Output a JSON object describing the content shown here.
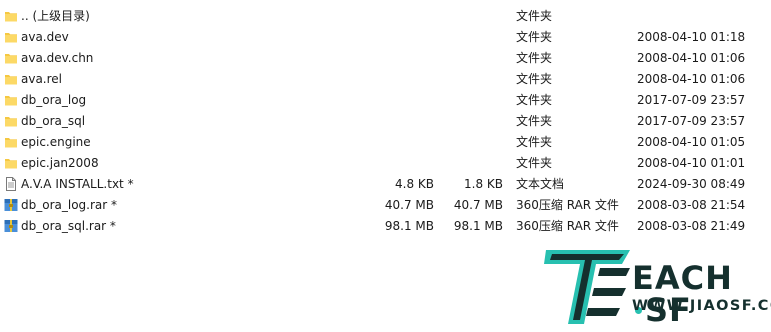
{
  "files": [
    {
      "name": ".. (上级目录)",
      "size": "",
      "packed": "",
      "type": "文件夹",
      "date": "",
      "icon": "folder-icon"
    },
    {
      "name": "ava.dev",
      "size": "",
      "packed": "",
      "type": "文件夹",
      "date": "2008-04-10 01:18",
      "icon": "folder-icon"
    },
    {
      "name": "ava.dev.chn",
      "size": "",
      "packed": "",
      "type": "文件夹",
      "date": "2008-04-10 01:06",
      "icon": "folder-icon"
    },
    {
      "name": "ava.rel",
      "size": "",
      "packed": "",
      "type": "文件夹",
      "date": "2008-04-10 01:06",
      "icon": "folder-icon"
    },
    {
      "name": "db_ora_log",
      "size": "",
      "packed": "",
      "type": "文件夹",
      "date": "2017-07-09 23:57",
      "icon": "folder-icon"
    },
    {
      "name": "db_ora_sql",
      "size": "",
      "packed": "",
      "type": "文件夹",
      "date": "2017-07-09 23:57",
      "icon": "folder-icon"
    },
    {
      "name": "epic.engine",
      "size": "",
      "packed": "",
      "type": "文件夹",
      "date": "2008-04-10 01:05",
      "icon": "folder-icon"
    },
    {
      "name": "epic.jan2008",
      "size": "",
      "packed": "",
      "type": "文件夹",
      "date": "2008-04-10 01:01",
      "icon": "folder-icon"
    },
    {
      "name": "A.V.A INSTALL.txt *",
      "size": "4.8 KB",
      "packed": "1.8 KB",
      "type": "文本文档",
      "date": "2024-09-30 08:49",
      "icon": "text-file-icon"
    },
    {
      "name": "db_ora_log.rar *",
      "size": "40.7 MB",
      "packed": "40.7 MB",
      "type": "360压缩 RAR 文件",
      "date": "2008-03-08 21:54",
      "icon": "rar-archive-icon"
    },
    {
      "name": "db_ora_sql.rar *",
      "size": "98.1 MB",
      "packed": "98.1 MB",
      "type": "360压缩 RAR 文件",
      "date": "2008-03-08 21:49",
      "icon": "rar-archive-icon"
    }
  ],
  "watermark": {
    "brand_left": "EACH",
    "brand_right": "SF",
    "url": "WWW.JIAOSF.COM",
    "colors": {
      "dark": "#15302e",
      "accent": "#27c0b0"
    }
  }
}
